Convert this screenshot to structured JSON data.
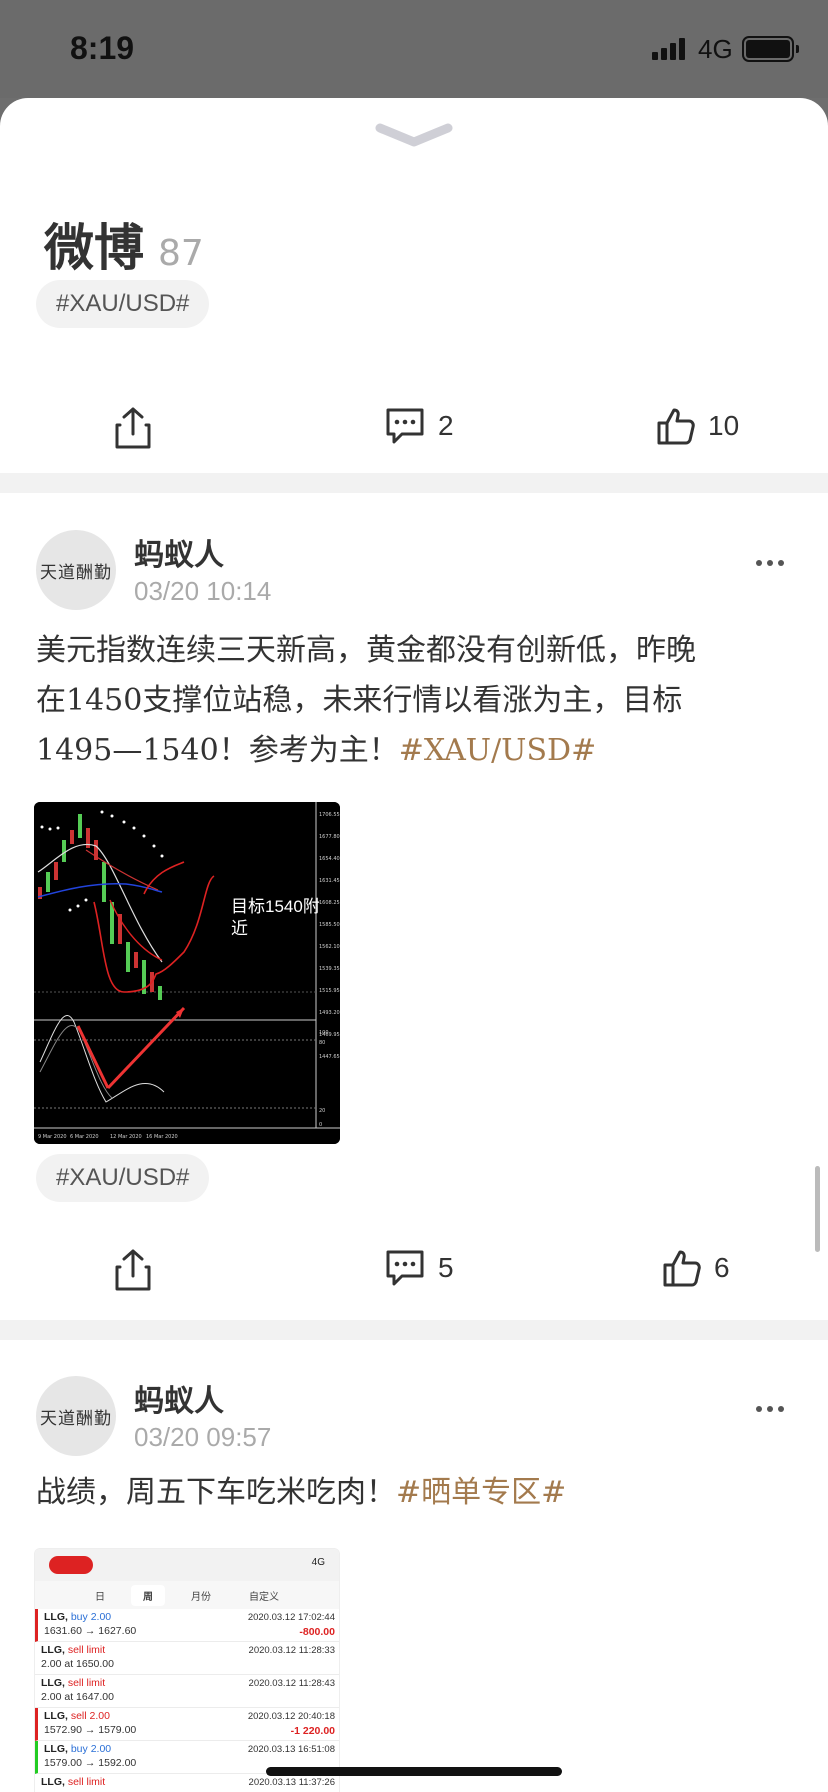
{
  "status": {
    "time": "8:19",
    "network": "4G"
  },
  "sheet": {
    "title": "微博",
    "count": "87"
  },
  "prev_post": {
    "tag": "#XAU/USD#",
    "comments": "2",
    "likes": "10"
  },
  "posts": [
    {
      "author": "蚂蚁人",
      "avatar_text": "天道酬勤",
      "time": "03/20 10:14",
      "text_lines": [
        "美元指数连续三天新高，黄金都没有创新低，昨晚",
        "在1450支撑位站稳，未来行情以看涨为主，目标",
        "1495—1540！参考为主！"
      ],
      "hashtag": "#XAU/USD#",
      "image_annotation_line1": "目标1540附",
      "image_annotation_line2": "近",
      "tag": "#XAU/USD#",
      "comments": "5",
      "likes": "6"
    },
    {
      "author": "蚂蚁人",
      "avatar_text": "天道酬勤",
      "time": "03/20 09:57",
      "text": "战绩，周五下车吃米吃肉！",
      "hashtag": "#晒单专区#"
    }
  ],
  "trade_screenshot": {
    "status_right": "4G",
    "tabs": [
      "日",
      "周",
      "月份",
      "自定义"
    ],
    "active_tab": "周",
    "rows": [
      {
        "symbol": "LLG,",
        "type": "buy 2.00",
        "side": "buy",
        "datetime": "2020.03.12 17:02:44",
        "price": "1631.60 → 1627.60",
        "pl": "-800.00",
        "mark": "red"
      },
      {
        "symbol": "LLG,",
        "type": "sell limit",
        "side": "sell",
        "datetime": "2020.03.12 11:28:33",
        "price": "2.00 at 1650.00",
        "pl": "",
        "mark": ""
      },
      {
        "symbol": "LLG,",
        "type": "sell limit",
        "side": "sell",
        "datetime": "2020.03.12 11:28:43",
        "price": "2.00 at 1647.00",
        "pl": "",
        "mark": ""
      },
      {
        "symbol": "LLG,",
        "type": "sell 2.00",
        "side": "sell",
        "datetime": "2020.03.12 20:40:18",
        "price": "1572.90 → 1579.00",
        "pl": "-1 220.00",
        "mark": "red"
      },
      {
        "symbol": "LLG,",
        "type": "buy 2.00",
        "side": "buy",
        "datetime": "2020.03.13 16:51:08",
        "price": "1579.00 → 1592.00",
        "pl": "",
        "mark": "green"
      },
      {
        "symbol": "LLG,",
        "type": "sell limit",
        "side": "sell",
        "datetime": "2020.03.13 11:37:26",
        "price": "",
        "pl": "",
        "mark": ""
      }
    ]
  },
  "icons": {
    "share": "share-icon",
    "comment": "comment-icon",
    "like": "thumbs-up-icon",
    "more": "more-dots-icon",
    "collapse": "chevron-down-icon"
  },
  "colors": {
    "hashtag": "#a37a4d",
    "loss": "#dd2222",
    "buy": "#2a6fd6"
  }
}
